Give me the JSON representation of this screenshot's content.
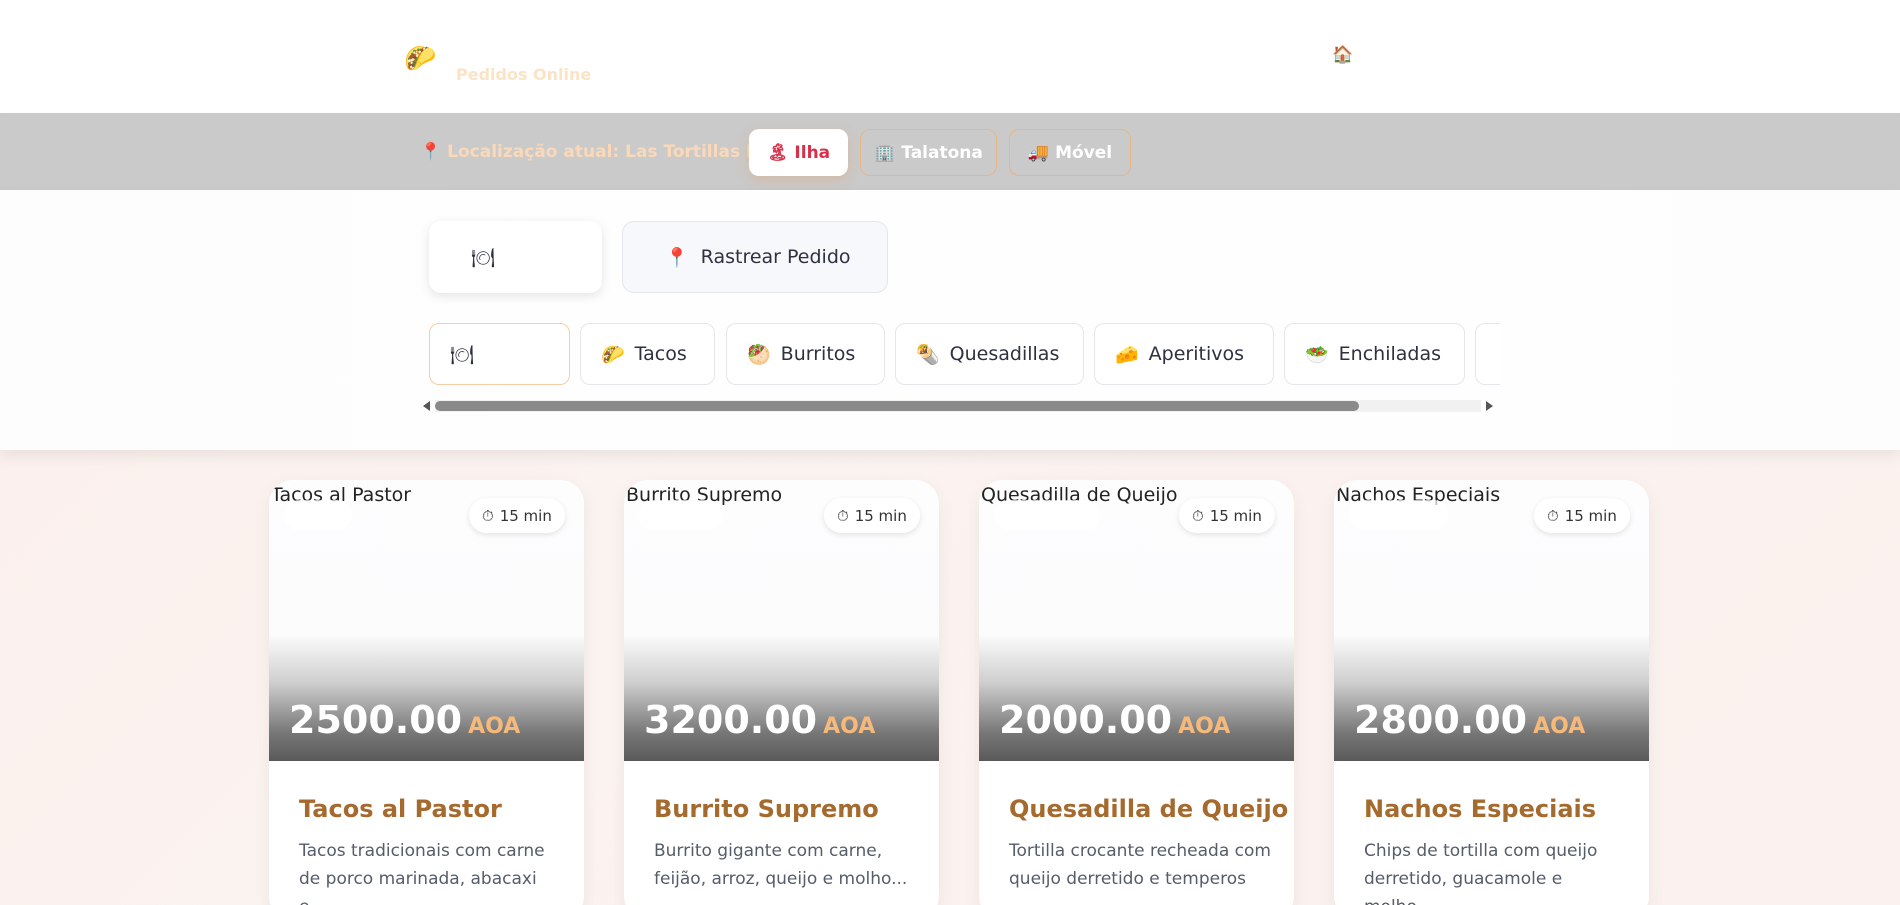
{
  "header": {
    "subtitle": "Pedidos Online",
    "logo_icon": "taco-icon",
    "home_icon": "home-icon"
  },
  "location": {
    "label": "Localização atual: Las Tortillas Ilha",
    "buttons": [
      {
        "emoji": "🏝",
        "label": "Ilha",
        "active": true
      },
      {
        "emoji": "🏢",
        "label": "Talatona",
        "active": false
      },
      {
        "emoji": "🚚",
        "label": "Móvel",
        "active": false
      }
    ]
  },
  "views": {
    "menu_emoji": "🍽",
    "track_emoji": "📍",
    "track_label": "Rastrear Pedido"
  },
  "categories": [
    {
      "emoji": "🍽",
      "label": ""
    },
    {
      "emoji": "🌮",
      "label": "Tacos"
    },
    {
      "emoji": "🥙",
      "label": "Burritos"
    },
    {
      "emoji": "🌯",
      "label": "Quesadillas"
    },
    {
      "emoji": "🧀",
      "label": "Aperitivos"
    },
    {
      "emoji": "🥗",
      "label": "Enchiladas"
    }
  ],
  "products": [
    {
      "alt": "Tacos al Pastor",
      "time": "15 min",
      "price": "2500.00",
      "currency": "AOA",
      "name": "Tacos al Pastor",
      "desc": "Tacos tradicionais com carne de porco marinada, abacaxi e..."
    },
    {
      "alt": "Burrito Supremo",
      "time": "15 min",
      "price": "3200.00",
      "currency": "AOA",
      "name": "Burrito Supremo",
      "desc": "Burrito gigante com carne, feijão, arroz, queijo e molho..."
    },
    {
      "alt": "Quesadilla de Queijo",
      "time": "15 min",
      "price": "2000.00",
      "currency": "AOA",
      "name": "Quesadilla de Queijo",
      "desc": "Tortilla crocante recheada com queijo derretido e temperos"
    },
    {
      "alt": "Nachos Especiais",
      "time": "15 min",
      "price": "2800.00",
      "currency": "AOA",
      "name": "Nachos Especiais",
      "desc": "Chips de tortilla com queijo derretido, guacamole e molho..."
    }
  ]
}
